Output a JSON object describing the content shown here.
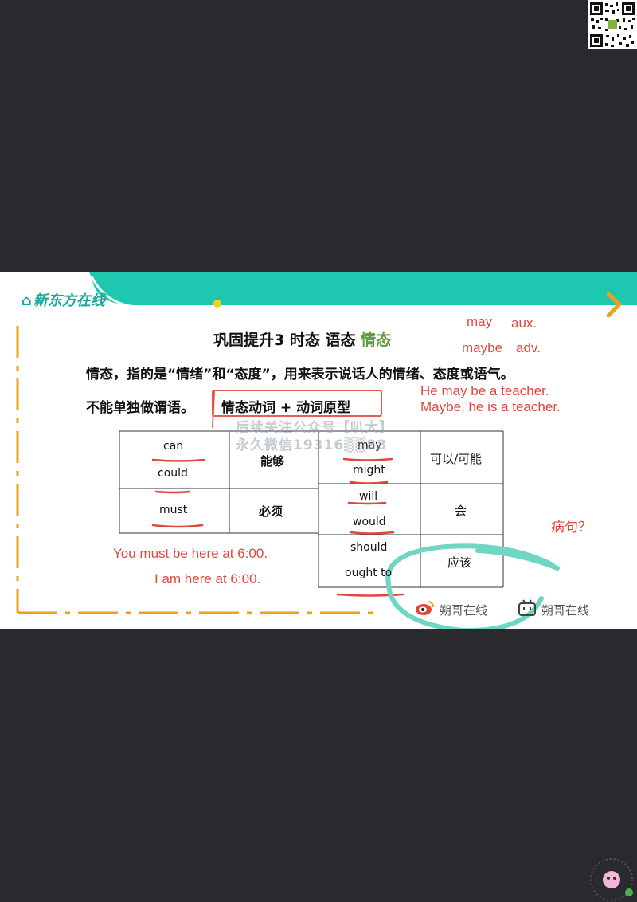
{
  "brand": {
    "logo_text": "新东方在线"
  },
  "slide": {
    "title_main": "巩固提升3 时态 语态 ",
    "title_highlight": "情态",
    "line1": "情态，指的是“情绪”和“态度”，用来表示说话人的情绪、态度或语气。",
    "line2": "不能单独做谓语。",
    "formula": "情态动词 + 动词原型"
  },
  "table_left": {
    "rows": [
      {
        "words": [
          "can",
          "could"
        ],
        "meaning": "能够"
      },
      {
        "words": [
          "must"
        ],
        "meaning": "必须"
      }
    ]
  },
  "table_right": {
    "rows": [
      {
        "words": [
          "may",
          "might"
        ],
        "meaning": "可以/可能"
      },
      {
        "words": [
          "will",
          "would"
        ],
        "meaning": "会"
      },
      {
        "words": [
          "should",
          "ought to"
        ],
        "meaning": "应该"
      }
    ]
  },
  "annotations": {
    "may": "may",
    "aux": "aux.",
    "maybe": "maybe",
    "adv": "adv.",
    "ex1": "He may be a teacher.",
    "ex2": "Maybe, he is a teacher.",
    "sick_sentence": "病句？",
    "must_ex": "You must be here at 6:00.",
    "am_ex": "I am here at 6:00."
  },
  "watermark": {
    "line1": "后续关注公众号【叭大】",
    "line2": "永久微信19316▒▒88"
  },
  "footer": {
    "weibo_text": "朔哥在线",
    "bili_text": "朔哥在线"
  },
  "colors": {
    "teal": "#1ec7b0",
    "orange": "#e8a317",
    "red": "#e0483c"
  }
}
